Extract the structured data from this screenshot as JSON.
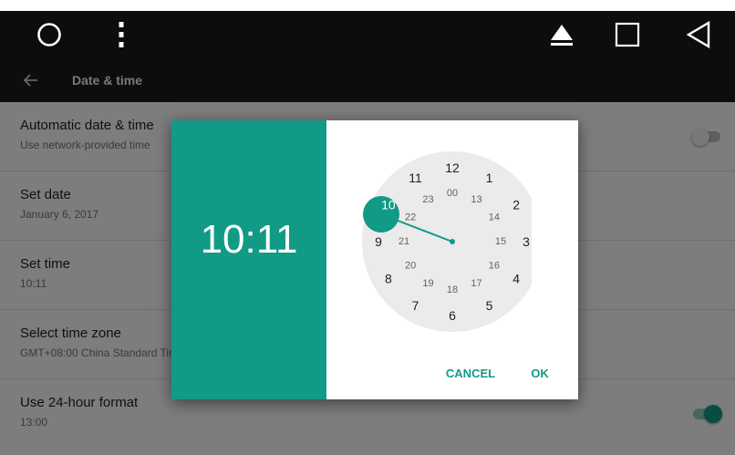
{
  "colors": {
    "accent": "#119a86",
    "navbar": "#0d0d0d",
    "appbar": "#1a1a1a"
  },
  "navbar": {
    "icons": [
      "circle-home-icon",
      "vertical-dots-menu-icon",
      "eject-icon",
      "square-recents-icon",
      "triangle-back-icon"
    ]
  },
  "appbar": {
    "back_icon": "arrow-left-icon",
    "title": "Date & time"
  },
  "settings": {
    "items": [
      {
        "title": "Automatic date & time",
        "subtitle": "Use network-provided time",
        "toggle": "off"
      },
      {
        "title": "Set date",
        "subtitle": "January 6, 2017"
      },
      {
        "title": "Set time",
        "subtitle": "10:11"
      },
      {
        "title": "Select time zone",
        "subtitle": "GMT+08:00 China Standard Time"
      },
      {
        "title": "Use 24-hour format",
        "subtitle": "13:00",
        "toggle": "on"
      }
    ]
  },
  "dialog": {
    "time": "10:11",
    "selected_hour": "10",
    "outer_hours": [
      "12",
      "1",
      "2",
      "3",
      "4",
      "5",
      "6",
      "7",
      "8",
      "9",
      "10",
      "11"
    ],
    "inner_hours": [
      "00",
      "13",
      "14",
      "15",
      "16",
      "17",
      "18",
      "19",
      "20",
      "21",
      "22",
      "23"
    ],
    "cancel_label": "CANCEL",
    "ok_label": "OK"
  }
}
